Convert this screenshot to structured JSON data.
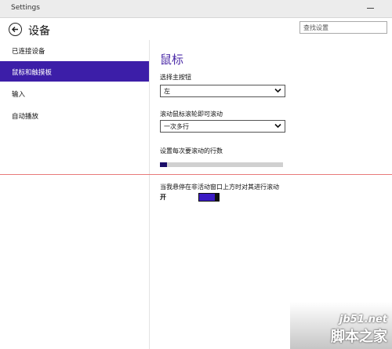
{
  "window": {
    "title": "Settings"
  },
  "header": {
    "title": "设备",
    "search_placeholder": "查找设置"
  },
  "sidebar": {
    "items": [
      {
        "label": "已连接设备",
        "selected": false
      },
      {
        "label": "鼠标和触摸板",
        "selected": true
      },
      {
        "label": "输入",
        "selected": false
      },
      {
        "label": "自动播放",
        "selected": false
      }
    ]
  },
  "main": {
    "section_title": "鼠标",
    "primary_button": {
      "label": "选择主按钮",
      "value": "左"
    },
    "wheel_scroll": {
      "label": "滚动鼠标滚轮即可滚动",
      "value": "一次多行"
    },
    "lines_per_scroll": {
      "label": "设置每次要滚动的行数",
      "level_fraction": 0.06
    },
    "inactive_scroll": {
      "label": "当我悬停在非活动窗口上方时对其进行滚动",
      "state": "开",
      "on": true
    }
  },
  "colors": {
    "accent": "#3c1ea8",
    "section_title": "#4b2aa7",
    "annotation_line": "#e87a7a"
  },
  "watermark": {
    "url": "jb51.net",
    "name": "脚本之家"
  }
}
